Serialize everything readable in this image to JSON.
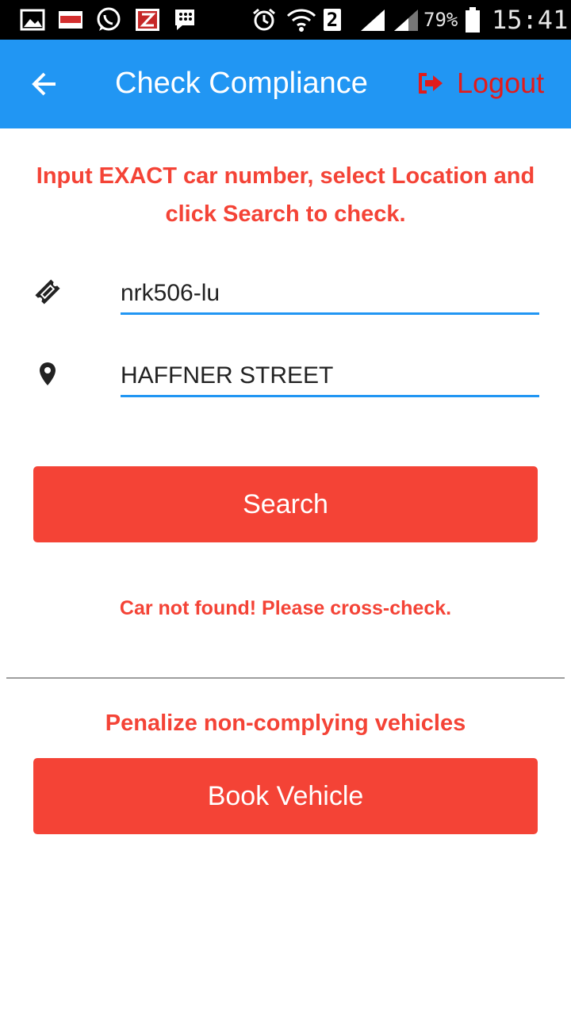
{
  "status_bar": {
    "notif_icons": [
      "gallery-icon",
      "punch-app-icon",
      "whatsapp-icon",
      "z-app-icon",
      "blackberry-messenger-icon"
    ],
    "sim_slot": "2",
    "battery": "79%",
    "time": "15:41"
  },
  "header": {
    "title": "Check Compliance",
    "logout_label": "Logout",
    "background_color": "#2196f3",
    "logout_color": "#e21b1b"
  },
  "instructions": "Input EXACT car number, select Location and click Search to check.",
  "form": {
    "car_number": "nrk506-lu",
    "location": "HAFFNER STREET",
    "search_label": "Search"
  },
  "result_message": "Car not found! Please cross-check.",
  "penalize": {
    "heading": "Penalize non-complying vehicles",
    "button_label": "Book Vehicle"
  },
  "accent_color": "#f44336"
}
